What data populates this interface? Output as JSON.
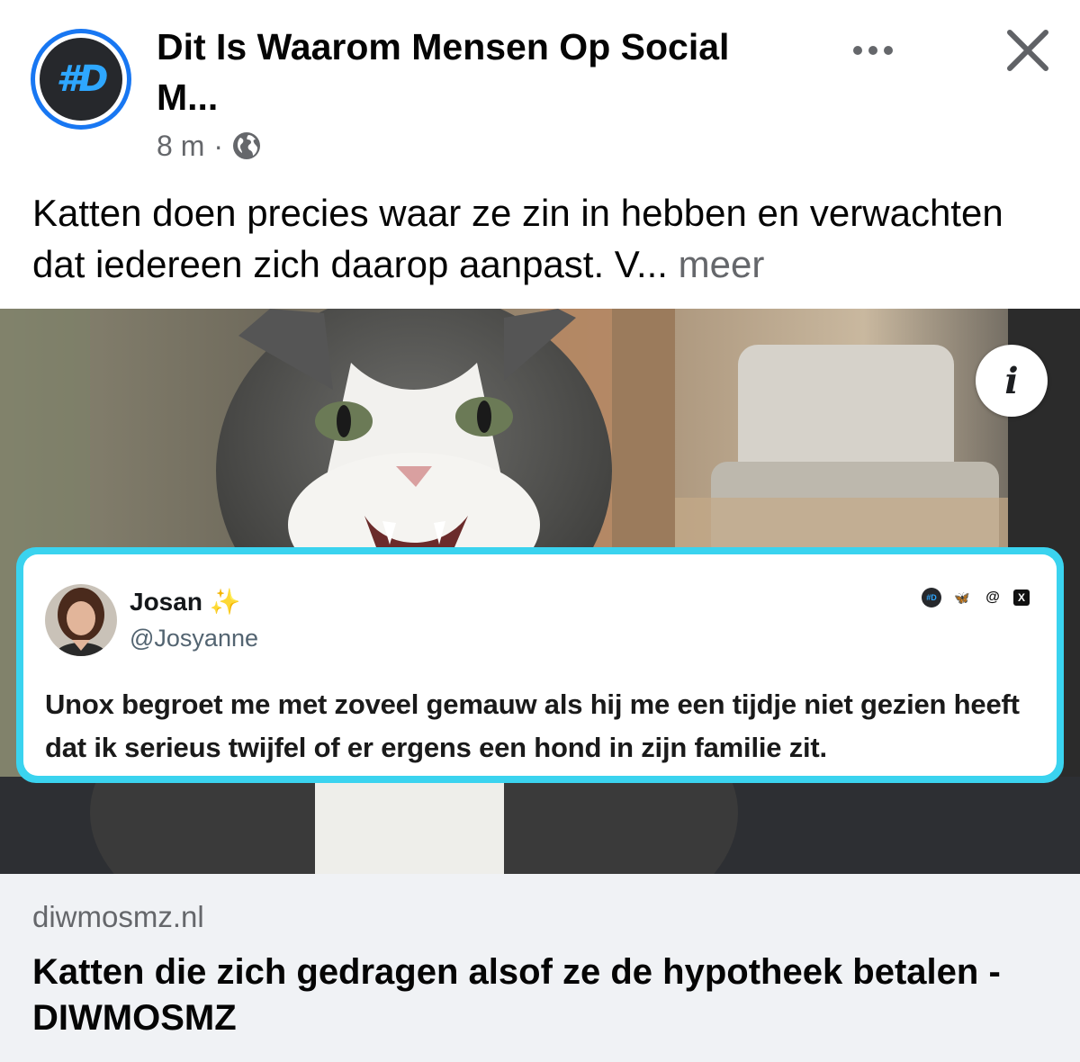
{
  "header": {
    "page_name_line1": "Dit Is Waarom Mensen Op Social",
    "page_name_line2": "M...",
    "avatar_text": "#D",
    "timestamp": "8 m",
    "separator": "·",
    "privacy_icon": "globe-icon",
    "more_icon": "more-horizontal-icon",
    "close_icon": "close-icon"
  },
  "caption": {
    "text": "Katten doen precies waar ze zin in hebben en verwachten dat iedereen zich daarop aanpast. V...",
    "more_label": "meer"
  },
  "media": {
    "info_label": "i",
    "tweet": {
      "name": "Josan",
      "sparkle": "✨",
      "handle": "@Josyanne",
      "text": "Unox begroet me met zoveel gemauw als hij me een tijdje niet gezien heeft dat ik serieus twijfel of er ergens een hond in zijn familie zit.",
      "social_icons": [
        "diwmosmz-icon",
        "bluesky-icon",
        "threads-icon",
        "x-icon"
      ],
      "social_labels": [
        "#D",
        "🦋",
        "@",
        "X"
      ]
    }
  },
  "link": {
    "domain": "diwmosmz.nl",
    "title": "Katten die zich gedragen alsof ze de hypotheek betalen - DIWMOSMZ"
  },
  "colors": {
    "brand_blue": "#1877f2",
    "tweet_border": "#3ad3ef",
    "secondary_text": "#65676b",
    "link_bg": "#f0f2f5"
  }
}
